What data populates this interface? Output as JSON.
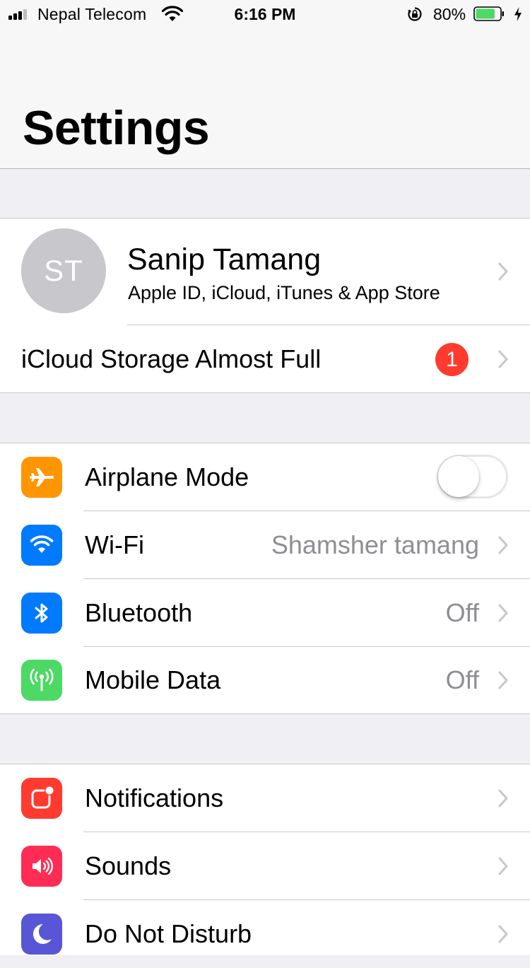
{
  "status_bar": {
    "carrier": "Nepal Telecom",
    "time": "6:16 PM",
    "battery_percent": "80%",
    "battery_level": 0.8,
    "battery_color": "#4cd964",
    "icons": [
      "cellular-signal-icon",
      "wifi-icon",
      "orientation-lock-icon",
      "battery-icon",
      "charging-bolt-icon"
    ]
  },
  "header": {
    "title": "Settings"
  },
  "profile": {
    "initials": "ST",
    "name": "Sanip Tamang",
    "subtitle": "Apple ID, iCloud, iTunes & App Store"
  },
  "icloud_storage": {
    "label": "iCloud Storage Almost Full",
    "badge": "1",
    "badge_color": "#ff3b30"
  },
  "connectivity": [
    {
      "label": "Airplane Mode",
      "icon": "airplane-icon",
      "icon_color": "#ff9500",
      "toggle_on": false
    },
    {
      "label": "Wi-Fi",
      "value": "Shamsher tamang",
      "icon": "wifi-icon",
      "icon_color": "#007aff"
    },
    {
      "label": "Bluetooth",
      "value": "Off",
      "icon": "bluetooth-icon",
      "icon_color": "#007aff"
    },
    {
      "label": "Mobile Data",
      "value": "Off",
      "icon": "antenna-icon",
      "icon_color": "#4cd964"
    }
  ],
  "general": [
    {
      "label": "Notifications",
      "icon": "notifications-icon",
      "icon_color": "#ff3b30"
    },
    {
      "label": "Sounds",
      "icon": "speaker-icon",
      "icon_color": "#ff2d55"
    },
    {
      "label": "Do Not Disturb",
      "icon": "moon-icon",
      "icon_color": "#5856d6"
    }
  ]
}
